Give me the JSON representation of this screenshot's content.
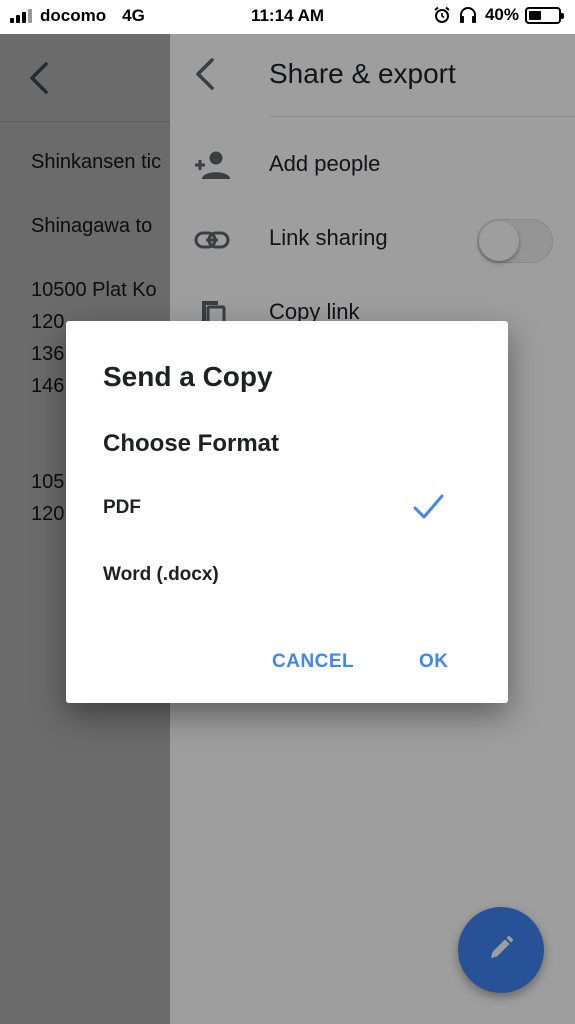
{
  "status_bar": {
    "carrier": "docomo",
    "network": "4G",
    "time": "11:14 AM",
    "battery": "40%",
    "battery_level": 0.4,
    "icons": [
      "signal-icon",
      "alarm-icon",
      "headphones-icon",
      "battery-icon"
    ]
  },
  "document": {
    "lines": [
      "Shinkansen tic",
      "",
      "Shinagawa to",
      "",
      "10500 Plat Ko",
      "120",
      "136",
      "146",
      "",
      "",
      "105",
      "120"
    ]
  },
  "panel": {
    "title": "Share & export",
    "items": [
      {
        "label": "Add people",
        "icon": "add-person-icon"
      },
      {
        "label": "Link sharing",
        "icon": "link-icon",
        "toggle_on": false
      },
      {
        "label": "Copy link",
        "icon": "copy-icon"
      }
    ]
  },
  "dialog": {
    "title": "Send a Copy",
    "subtitle": "Choose Format",
    "options": [
      {
        "label": "PDF",
        "selected": true
      },
      {
        "label": "Word (.docx)",
        "selected": false
      }
    ],
    "cancel_label": "CANCEL",
    "ok_label": "OK"
  },
  "colors": {
    "accent": "#4285f4",
    "scrim": "rgba(0,0,0,0.38)",
    "text": "#202124",
    "icon": "#5f6368"
  },
  "fab": {
    "icon": "pencil-icon"
  }
}
